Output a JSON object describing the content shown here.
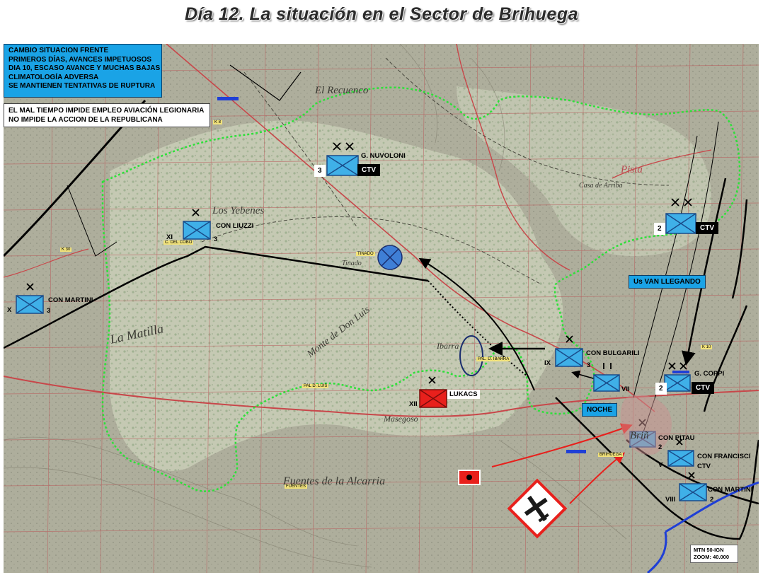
{
  "title": "Día 12. La situación en el Sector de Brihuega",
  "info_box": {
    "lines": [
      "CAMBIO SITUACION FRENTE",
      "PRIMEROS DÍAS, AVANCES IMPETUOSOS",
      "DIA 10, ESCASO AVANCE Y MUCHAS BAJAS",
      "CLIMATOLOGÍA ADVERSA",
      "SE MANTIENEN TENTATIVAS DE RUPTURA"
    ]
  },
  "weather_box": {
    "lines": [
      "EL MAL TIEMPO IMPIDE EMPLEO AVIACIÓN LEGIONARIA",
      "NO IMPIDE LA ACCION DE LA REPUBLICANA"
    ]
  },
  "units": {
    "nuvoloni": {
      "name": "G. NUVOLONI",
      "num": "3",
      "tag": "CTV"
    },
    "liuzzi": {
      "name": "CON LIUZZI",
      "roman": "XI",
      "num": "3"
    },
    "martini_w": {
      "name": "CON MARTINI",
      "roman": "X",
      "num": "3"
    },
    "ctv_ne": {
      "num": "2",
      "tag": "CTV"
    },
    "bulgarili": {
      "name": "CON BULGARILI",
      "roman": "IX",
      "num": "3"
    },
    "vii": {
      "roman": "VII"
    },
    "coppi": {
      "name": "G. COPPI",
      "num": "2",
      "tag": "CTV"
    },
    "lukacs": {
      "name": "LUKACS",
      "roman": "XII"
    },
    "pitau": {
      "name": "CON PITAU",
      "num": "2"
    },
    "francisci": {
      "name": "CON FRANCISCI",
      "roman": "V",
      "tag": "CTV"
    },
    "martini_se": {
      "name": "CON MARTINI",
      "roman": "VIII",
      "num": "2"
    }
  },
  "tags": {
    "us_van_llegando": "Us VAN LLEGANDO",
    "noche": "NOCHE"
  },
  "places": {
    "recuenco": "El Recuenco",
    "yebenes": "Los Yebenes",
    "matilla": "La Matilla",
    "fuentes": "Fuentes de la Alcarria",
    "pista": "Pista",
    "ibarra": "Ibarra",
    "masegoso": "Masegoso",
    "don_luis": "Monte de Don Luis",
    "casa_arriba": "Casa de Arriba",
    "tinado": "Tinado",
    "brihuega": "Briñ"
  },
  "small_labels": {
    "tinado": "TINADO",
    "pal_ibarra": "PAL. D. IBARRA",
    "pal_luis": "PAL D. LUIS",
    "fuentes": "FUENTES",
    "cobo": "C. DEL COBO",
    "brihuega": "BRIHUEGA",
    "k30": "K 30",
    "k8": "K 8",
    "k10": "K 10"
  },
  "mtn_box": {
    "line1": "MTN 50-IGN",
    "line2": "ZOOM: 40.000"
  },
  "colors": {
    "friendly_blue": "#3fb0e8",
    "enemy_red": "#e8201c",
    "front_green": "#2ee03a",
    "arrow_black": "#000000",
    "arrow_red": "#e8201c",
    "road_red": "#c8474a",
    "river_blue": "#1f3fd6",
    "grid_red": "#b85a5a"
  },
  "icons": {
    "aircraft": "aircraft-warning-icon",
    "enemy_flag": "enemy-flag-icon",
    "reserve": "circle-reserve-icon"
  }
}
